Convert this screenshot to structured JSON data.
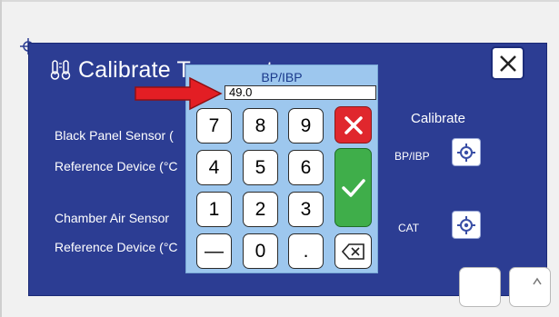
{
  "dialog": {
    "title": "Calibrate Temperature"
  },
  "sensors": {
    "black_panel_label": "Black Panel Sensor (",
    "black_panel_ref_label": "Reference Device (°C",
    "chamber_label": "Chamber Air Sensor",
    "chamber_ref_label": "Reference Device (°C"
  },
  "calibrate": {
    "header": "Calibrate",
    "bp_label": "BP/IBP",
    "cat_label": "CAT"
  },
  "keypad": {
    "title": "BP/IBP",
    "entry_value": "49.0",
    "keys": [
      "7",
      "8",
      "9",
      "4",
      "5",
      "6",
      "1",
      "2",
      "3",
      "—",
      "0",
      "."
    ]
  },
  "icons": {
    "close": "close-icon",
    "thermometer": "thermometer-icon",
    "target": "crosshair-target-icon",
    "backspace": "backspace-icon",
    "cancel": "x-cancel-icon",
    "confirm": "checkmark-icon"
  },
  "colors": {
    "panel_bg": "#2c3d93",
    "keypad_bg": "#9dc7ee",
    "cancel_red": "#e0272d",
    "confirm_green": "#3fae4a",
    "annotation_arrow": "#e31e24"
  }
}
